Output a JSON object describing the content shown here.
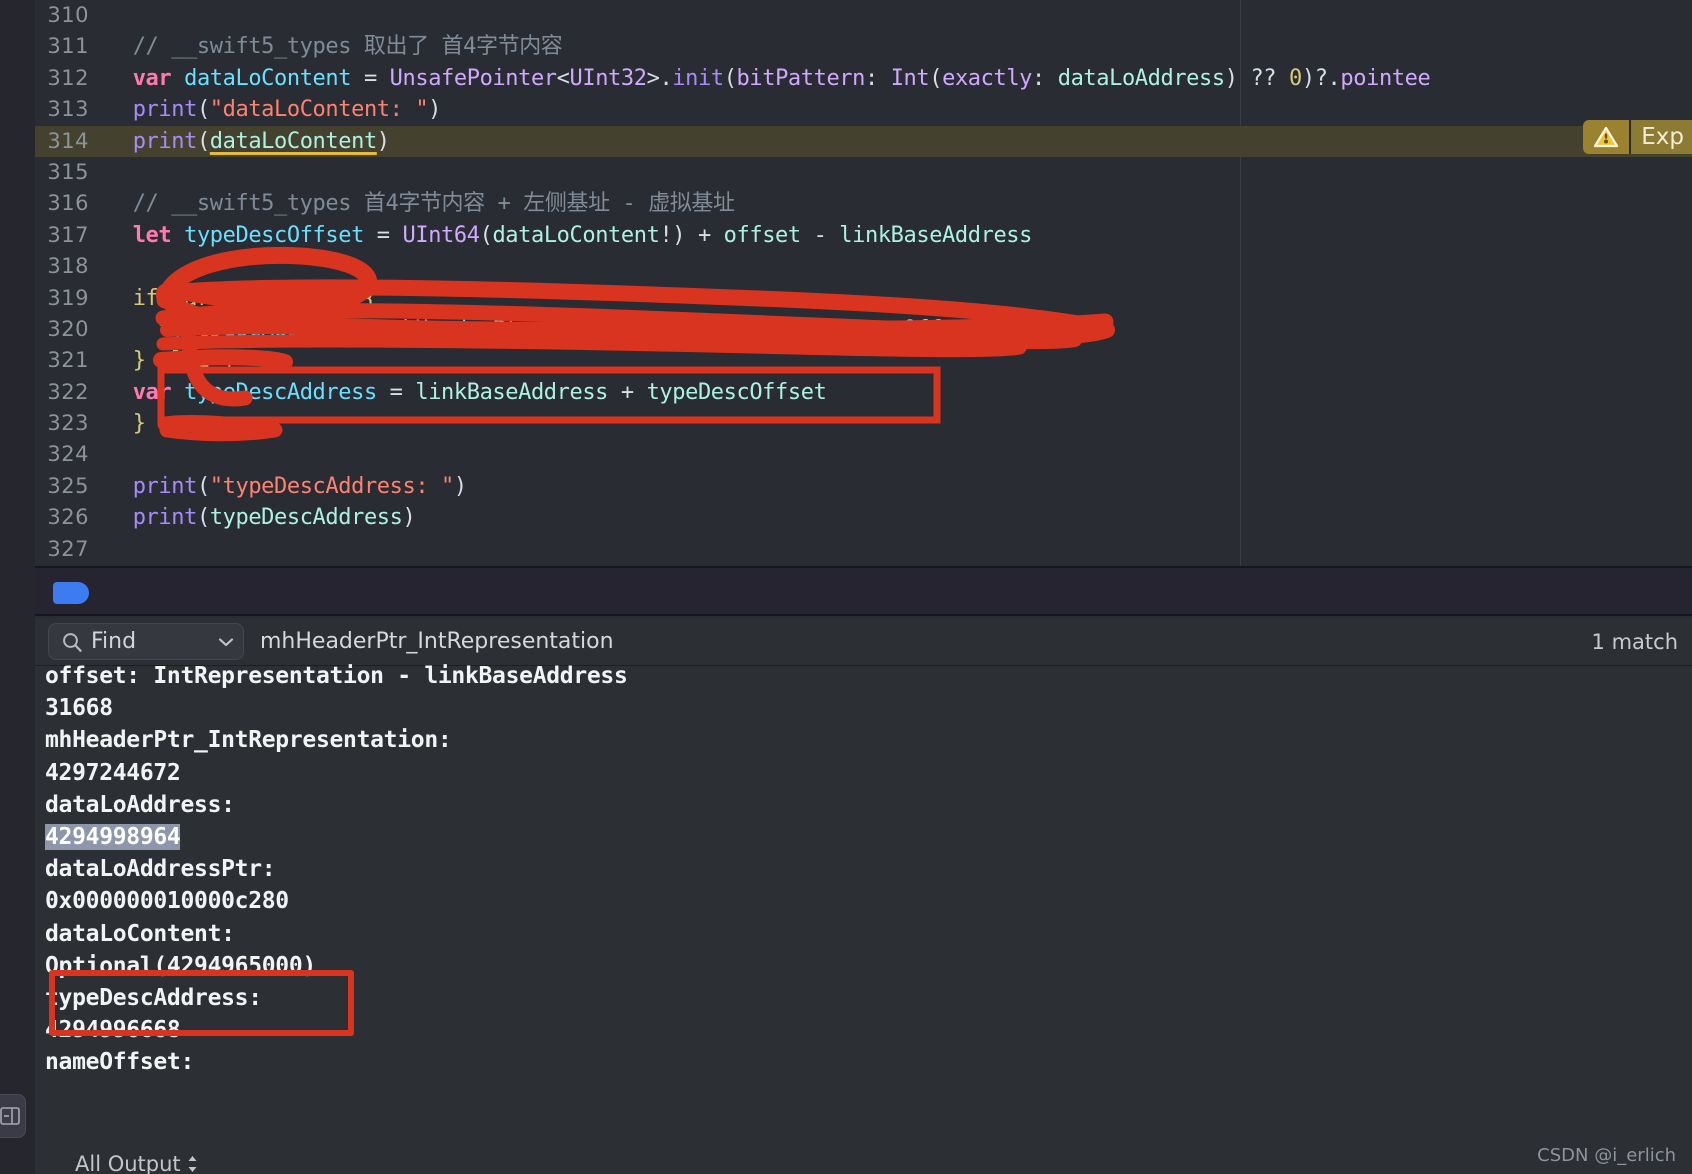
{
  "editor": {
    "gutter_start": 310,
    "lines": [
      {
        "n": "310",
        "tokens": []
      },
      {
        "n": "311",
        "tokens": [
          {
            "t": "  // __swift5_types 取出了 首4字节内容",
            "c": "c-com"
          }
        ]
      },
      {
        "n": "312",
        "tokens": [
          {
            "t": "  ",
            "c": "c-pl"
          },
          {
            "t": "var",
            "c": "c-kw"
          },
          {
            "t": " ",
            "c": "c-pl"
          },
          {
            "t": "dataLoContent",
            "c": "c-var"
          },
          {
            "t": " = ",
            "c": "c-op"
          },
          {
            "t": "UnsafePointer",
            "c": "c-type"
          },
          {
            "t": "<",
            "c": "c-op"
          },
          {
            "t": "UInt32",
            "c": "c-type"
          },
          {
            "t": ">.",
            "c": "c-op"
          },
          {
            "t": "init",
            "c": "c-fn"
          },
          {
            "t": "(",
            "c": "c-op"
          },
          {
            "t": "bitPattern",
            "c": "c-type"
          },
          {
            "t": ": ",
            "c": "c-op"
          },
          {
            "t": "Int",
            "c": "c-type"
          },
          {
            "t": "(",
            "c": "c-op"
          },
          {
            "t": "exactly",
            "c": "c-type"
          },
          {
            "t": ": ",
            "c": "c-op"
          },
          {
            "t": "dataLoAddress",
            "c": "c-id"
          },
          {
            "t": ") ",
            "c": "c-op"
          },
          {
            "t": "??",
            "c": "c-op"
          },
          {
            "t": " ",
            "c": "c-pl"
          },
          {
            "t": "0",
            "c": "c-num"
          },
          {
            "t": ")?.",
            "c": "c-op"
          },
          {
            "t": "pointee",
            "c": "c-type"
          }
        ]
      },
      {
        "n": "313",
        "tokens": [
          {
            "t": "  ",
            "c": "c-pl"
          },
          {
            "t": "print",
            "c": "c-fn"
          },
          {
            "t": "(",
            "c": "c-op"
          },
          {
            "t": "\"dataLoContent: \"",
            "c": "c-str"
          },
          {
            "t": ")",
            "c": "c-op"
          }
        ]
      },
      {
        "n": "314",
        "highlight": true,
        "warning": true,
        "tokens": [
          {
            "t": "  ",
            "c": "c-pl"
          },
          {
            "t": "print",
            "c": "c-fn"
          },
          {
            "t": "(",
            "c": "c-op"
          },
          {
            "t": "dataLoContent",
            "c": "c-id u-warn"
          },
          {
            "t": ")",
            "c": "c-op"
          }
        ]
      },
      {
        "n": "315",
        "tokens": []
      },
      {
        "n": "316",
        "tokens": [
          {
            "t": "  // __swift5_types 首4字节内容 + 左侧基址 - 虚拟基址",
            "c": "c-com"
          }
        ]
      },
      {
        "n": "317",
        "tokens": [
          {
            "t": "  ",
            "c": "c-pl"
          },
          {
            "t": "let",
            "c": "c-kw"
          },
          {
            "t": " ",
            "c": "c-pl"
          },
          {
            "t": "typeDescOffset",
            "c": "c-var"
          },
          {
            "t": " = ",
            "c": "c-op"
          },
          {
            "t": "UInt64",
            "c": "c-type"
          },
          {
            "t": "(",
            "c": "c-op"
          },
          {
            "t": "dataLoContent",
            "c": "c-id"
          },
          {
            "t": "!) + ",
            "c": "c-op"
          },
          {
            "t": "offset",
            "c": "c-id"
          },
          {
            "t": " - ",
            "c": "c-op"
          },
          {
            "t": "linkBaseAddress",
            "c": "c-id"
          }
        ]
      },
      {
        "n": "318",
        "tokens": []
      },
      {
        "n": "319",
        "scribbled": true,
        "tokens": [
          {
            "t": "  if (arch(x86_64)) {",
            "c": "c-num"
          }
        ]
      },
      {
        "n": "320",
        "scribbled": true,
        "tokens": [
          {
            "t": "    typeDescAddress = mhHeaderPtr_IntRepresentation + typeDescOffset",
            "c": "c-var"
          }
        ]
      },
      {
        "n": "321",
        "scribbled": true,
        "tokens": [
          {
            "t": "  } else {",
            "c": "c-num"
          }
        ]
      },
      {
        "n": "322",
        "boxed": true,
        "tokens": [
          {
            "t": "  ",
            "c": "c-pl"
          },
          {
            "t": "var",
            "c": "c-kw"
          },
          {
            "t": " ",
            "c": "c-pl"
          },
          {
            "t": "typeDescAddress",
            "c": "c-var"
          },
          {
            "t": " = ",
            "c": "c-op"
          },
          {
            "t": "linkBaseAddress",
            "c": "c-id"
          },
          {
            "t": " + ",
            "c": "c-op"
          },
          {
            "t": "typeDescOffset",
            "c": "c-id"
          }
        ]
      },
      {
        "n": "323",
        "scribbled": true,
        "tokens": [
          {
            "t": "  }",
            "c": "c-num"
          }
        ]
      },
      {
        "n": "324",
        "tokens": []
      },
      {
        "n": "325",
        "tokens": [
          {
            "t": "  ",
            "c": "c-pl"
          },
          {
            "t": "print",
            "c": "c-fn"
          },
          {
            "t": "(",
            "c": "c-op"
          },
          {
            "t": "\"typeDescAddress: \"",
            "c": "c-str"
          },
          {
            "t": ")",
            "c": "c-op"
          }
        ]
      },
      {
        "n": "326",
        "tokens": [
          {
            "t": "  ",
            "c": "c-pl"
          },
          {
            "t": "print",
            "c": "c-fn"
          },
          {
            "t": "(",
            "c": "c-op"
          },
          {
            "t": "typeDescAddress",
            "c": "c-id"
          },
          {
            "t": ")",
            "c": "c-op"
          }
        ]
      },
      {
        "n": "327",
        "tokens": []
      }
    ],
    "warning_chip": {
      "icon": "warning-triangle-icon",
      "label": "Exp"
    }
  },
  "find": {
    "scope_label": "Find",
    "scope_icon": "search-icon",
    "dropdown_icon": "chevron-down-icon",
    "query": "mhHeaderPtr_IntRepresentation",
    "placeholder": "Find",
    "match_count": "1 match"
  },
  "console": {
    "lines": [
      {
        "text": "offset: IntRepresentation - linkBaseAddress",
        "clipped": true
      },
      {
        "text": "31668"
      },
      {
        "text": "mhHeaderPtr_IntRepresentation:"
      },
      {
        "text": "4297244672"
      },
      {
        "text": "dataLoAddress:"
      },
      {
        "text": "4294998964",
        "selected": true
      },
      {
        "text": "dataLoAddressPtr:"
      },
      {
        "text": "0x000000010000c280"
      },
      {
        "text": "dataLoContent:"
      },
      {
        "text": "Optional(4294965000)"
      },
      {
        "text": "typeDescAddress:",
        "boxed": true
      },
      {
        "text": "4294996668",
        "boxed": true
      },
      {
        "text": "nameOffset:"
      }
    ],
    "filter_label": "All Output",
    "filter_icon": "up-down-chevron-icon"
  },
  "watermark": "CSDN @i_erlich",
  "colors": {
    "editor_bg": "#292c32",
    "console_bg": "#2c2f34",
    "line_highlight": "#45412f",
    "annotation_red": "#d8341f",
    "breakpoint_blue": "#3d7bf0",
    "warning_yellow": "#9a8230",
    "selection_blue": "#8d96ab"
  }
}
